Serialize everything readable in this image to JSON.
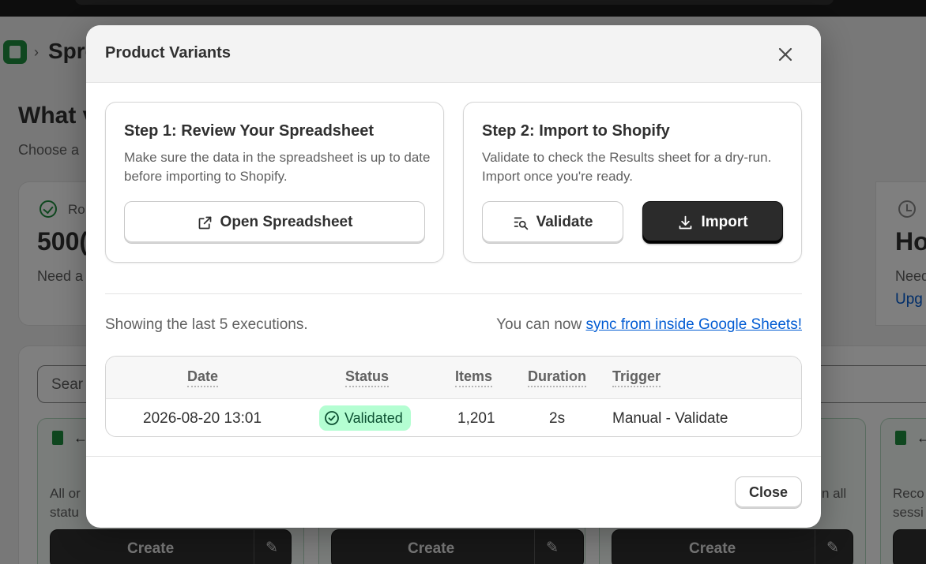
{
  "background": {
    "breadcrumb": "Spre",
    "heading": "What v",
    "subheading": "Choose a",
    "stat_left": {
      "label": "Ro",
      "value": "500(",
      "help": "Need a"
    },
    "stat_right": {
      "value": "Ho",
      "help": "Need",
      "link": "Upg"
    },
    "search_placeholder": "Sear",
    "tiles": [
      {
        "text1": "All or",
        "text2": "statu"
      },
      {
        "text1": "",
        "text2": ""
      },
      {
        "text1": "n all",
        "text2": ""
      },
      {
        "text1": "Reco",
        "text2": "sessi"
      }
    ],
    "create_label": "Create",
    "colors": {
      "overlay": "#000000",
      "dark_button": "#303030",
      "app_green": "#1e8e3e"
    }
  },
  "modal": {
    "title": "Product Variants",
    "step1": {
      "title": "Step 1: Review Your Spreadsheet",
      "description": "Make sure the data in the spreadsheet is up to date before importing to Shopify.",
      "button": "Open Spreadsheet",
      "button_icon": "external-link-icon"
    },
    "step2": {
      "title": "Step 2: Import to Shopify",
      "description": "Validate to check the Results sheet for a dry-run. Import once you're ready.",
      "validate_button": "Validate",
      "validate_icon": "search-list-icon",
      "import_button": "Import",
      "import_icon": "download-icon"
    },
    "executions_text": "Showing the last 5 executions.",
    "sync_prefix": "You can now ",
    "sync_link": "sync from inside Google Sheets!",
    "table": {
      "headers": {
        "date": "Date",
        "status": "Status",
        "items": "Items",
        "duration": "Duration",
        "trigger": "Trigger"
      },
      "rows": [
        {
          "date": "2026-08-20 13:01",
          "status": "Validated",
          "items": "1,201",
          "duration": "2s",
          "trigger": "Manual - Validate"
        }
      ]
    },
    "close_button": "Close",
    "colors": {
      "link": "#005bd3",
      "badge_bg": "#b4fed2",
      "badge_text": "#0c5132",
      "primary_button": "#2b2b2b"
    }
  }
}
